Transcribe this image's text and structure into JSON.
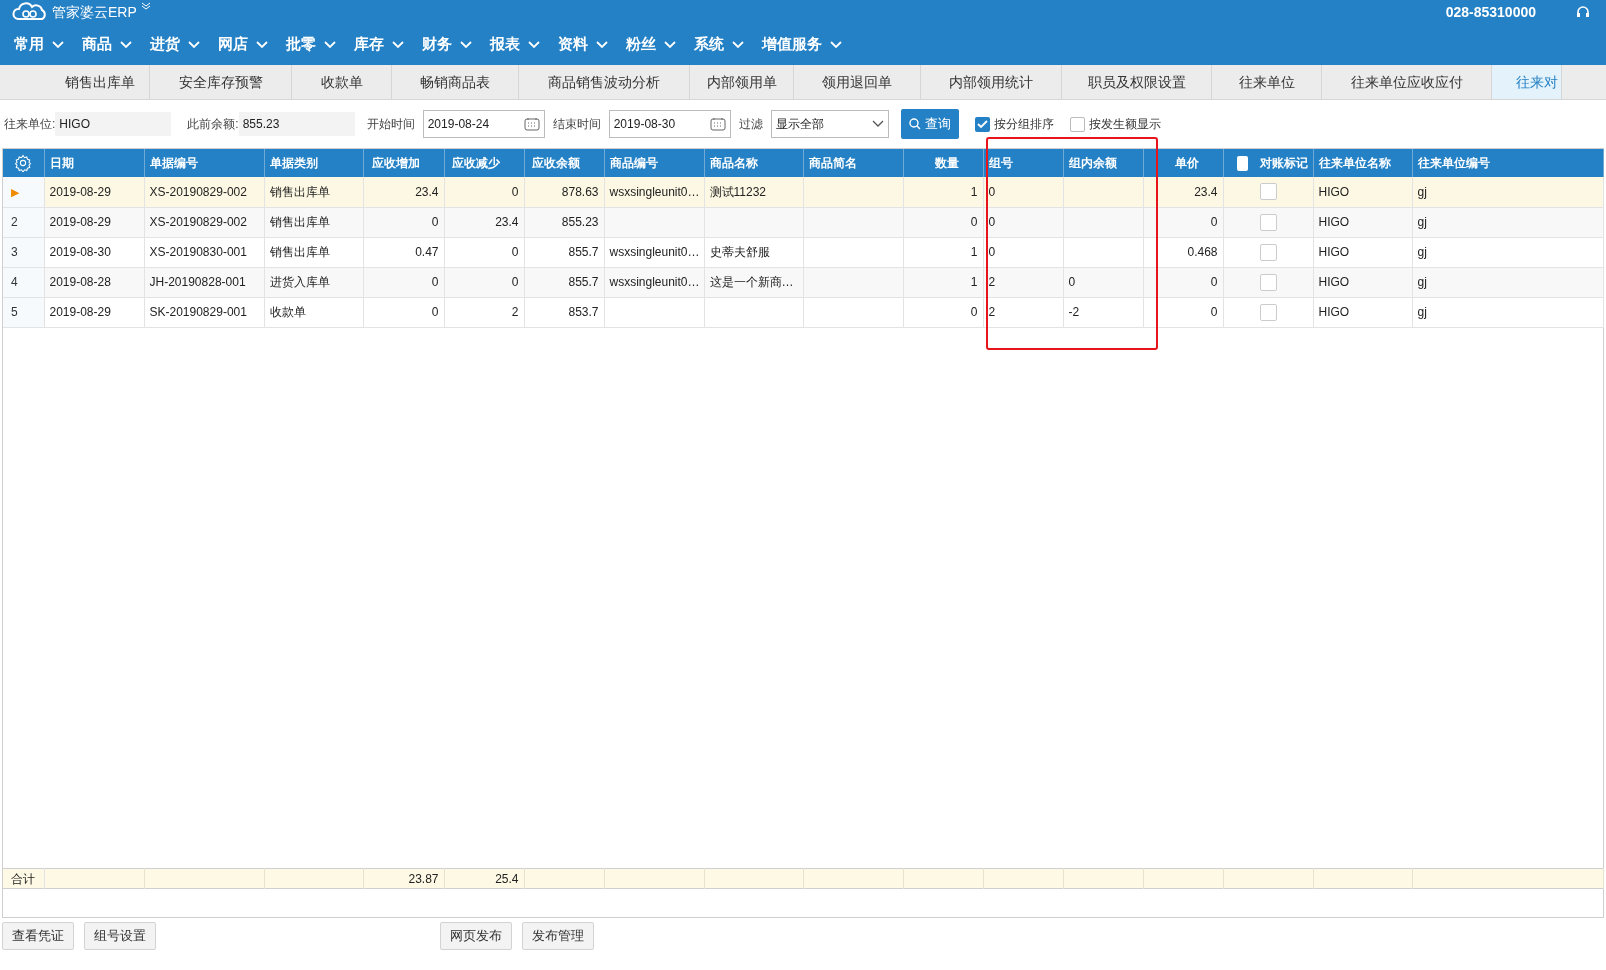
{
  "header": {
    "logo_text": "管家婆云ERP",
    "phone": "028-85310000"
  },
  "menu": [
    {
      "label": "常用"
    },
    {
      "label": "商品"
    },
    {
      "label": "进货"
    },
    {
      "label": "网店"
    },
    {
      "label": "批零"
    },
    {
      "label": "库存"
    },
    {
      "label": "财务"
    },
    {
      "label": "报表"
    },
    {
      "label": "资料"
    },
    {
      "label": "粉丝"
    },
    {
      "label": "系统"
    },
    {
      "label": "增值服务"
    }
  ],
  "tabs": [
    {
      "label": "销售出库单",
      "selected": false
    },
    {
      "label": "安全库存预警",
      "selected": false
    },
    {
      "label": "收款单",
      "selected": false
    },
    {
      "label": "畅销商品表",
      "selected": false
    },
    {
      "label": "商品销售波动分析",
      "selected": false
    },
    {
      "label": "内部领用单",
      "selected": false
    },
    {
      "label": "领用退回单",
      "selected": false
    },
    {
      "label": "内部领用统计",
      "selected": false
    },
    {
      "label": "职员及权限设置",
      "selected": false
    },
    {
      "label": "往来单位",
      "selected": false
    },
    {
      "label": "往来单位应收应付",
      "selected": false
    },
    {
      "label": "往来对",
      "selected": true
    }
  ],
  "filters": {
    "partner_label": "往来单位:",
    "partner_value": "HIGO",
    "prev_balance_label": "此前余额:",
    "prev_balance_value": "855.23",
    "start_label": "开始时间",
    "start_value": "2019-08-24",
    "end_label": "结束时间",
    "end_value": "2019-08-30",
    "filter_label": "过滤",
    "filter_value": "显示全部",
    "query_button": "查询",
    "options": [
      {
        "label": "按分组排序",
        "checked": true
      },
      {
        "label": "按发生额显示",
        "checked": false
      }
    ]
  },
  "table": {
    "columns": [
      "日期",
      "单据编号",
      "单据类别",
      "应收增加",
      "应收减少",
      "应收余额",
      "商品编号",
      "商品名称",
      "商品简名",
      "数量",
      "组号",
      "组内余额",
      "单价",
      "对账标记",
      "往来单位名称",
      "往来单位编号"
    ],
    "header_checkbox_checked": false,
    "rows": [
      {
        "row_header": "▶",
        "selected": true,
        "reconciled": false,
        "cells": [
          "2019-08-29",
          "XS-20190829-002",
          "销售出库单",
          "23.4",
          "0",
          "878.63",
          "wsxsingleunit0…",
          "测试11232",
          "",
          "1",
          "0",
          "",
          "23.4",
          "",
          "HIGO",
          "gj"
        ]
      },
      {
        "row_header": "2",
        "selected": false,
        "reconciled": false,
        "cells": [
          "2019-08-29",
          "XS-20190829-002",
          "销售出库单",
          "0",
          "23.4",
          "855.23",
          "",
          "",
          "",
          "0",
          "0",
          "",
          "0",
          "",
          "HIGO",
          "gj"
        ]
      },
      {
        "row_header": "3",
        "selected": false,
        "reconciled": false,
        "cells": [
          "2019-08-30",
          "XS-20190830-001",
          "销售出库单",
          "0.47",
          "0",
          "855.7",
          "wsxsingleunit0…",
          "史蒂夫舒服",
          "",
          "1",
          "0",
          "",
          "0.468",
          "",
          "HIGO",
          "gj"
        ]
      },
      {
        "row_header": "4",
        "selected": false,
        "reconciled": false,
        "cells": [
          "2019-08-28",
          "JH-20190828-001",
          "进货入库单",
          "0",
          "0",
          "855.7",
          "wsxsingleunit0…",
          "这是一个新商…",
          "",
          "1",
          "2",
          "0",
          "0",
          "",
          "HIGO",
          "gj"
        ]
      },
      {
        "row_header": "5",
        "selected": false,
        "reconciled": false,
        "cells": [
          "2019-08-29",
          "SK-20190829-001",
          "收款单",
          "0",
          "2",
          "853.7",
          "",
          "",
          "",
          "0",
          "2",
          "-2",
          "0",
          "",
          "HIGO",
          "gj"
        ]
      }
    ],
    "totals": {
      "label": "合计",
      "cells": [
        "",
        "",
        "",
        "23.87",
        "25.4",
        "",
        "",
        "",
        "",
        "",
        "",
        "",
        "",
        "",
        "",
        ""
      ]
    }
  },
  "buttons_left": [
    "查看凭证",
    "组号设置"
  ],
  "buttons_right": [
    "网页发布",
    "发布管理"
  ]
}
